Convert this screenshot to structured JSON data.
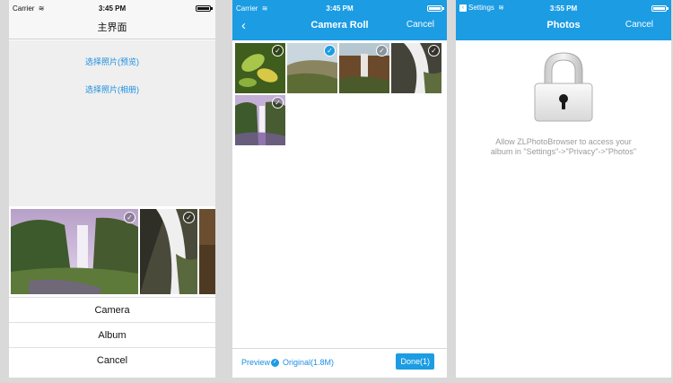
{
  "colors": {
    "accent": "#1c9ce3",
    "link": "#1e8fe0",
    "background": "#efefef"
  },
  "screen1": {
    "status": {
      "carrier": "Carrier",
      "time": "3:45 PM"
    },
    "title": "主界面",
    "links": [
      "选择照片(预览)",
      "选择照片(相册)"
    ],
    "strip_photos": [
      {
        "name": "waterfall-purple-sky",
        "selected": false
      },
      {
        "name": "waterfall-rocks-bw",
        "selected": false
      },
      {
        "name": "canyon-partial",
        "selected": false
      }
    ],
    "sheet": [
      "Camera",
      "Album",
      "Cancel"
    ]
  },
  "screen2": {
    "status": {
      "carrier": "Carrier",
      "time": "3:45 PM"
    },
    "back_icon": "chevron-left-icon",
    "title": "Camera Roll",
    "cancel": "Cancel",
    "photos": [
      {
        "name": "leaves-green",
        "selected": false
      },
      {
        "name": "hills-field",
        "selected": true
      },
      {
        "name": "canyon-waterfall",
        "selected": false
      },
      {
        "name": "waterfall-rocks-bw",
        "selected": false
      },
      {
        "name": "waterfall-purple-sky",
        "selected": false
      }
    ],
    "bottom": {
      "preview": "Preview",
      "original": "Original(1.8M)",
      "done": "Done(1)"
    }
  },
  "screen3": {
    "status": {
      "back_app": "Settings",
      "time": "3:55 PM"
    },
    "title": "Photos",
    "cancel": "Cancel",
    "lock_icon": "padlock-icon",
    "message_line1": "Allow ZLPhotoBrowser to access your",
    "message_line2": "album in \"Settings\"->\"Privacy\"->\"Photos\""
  }
}
